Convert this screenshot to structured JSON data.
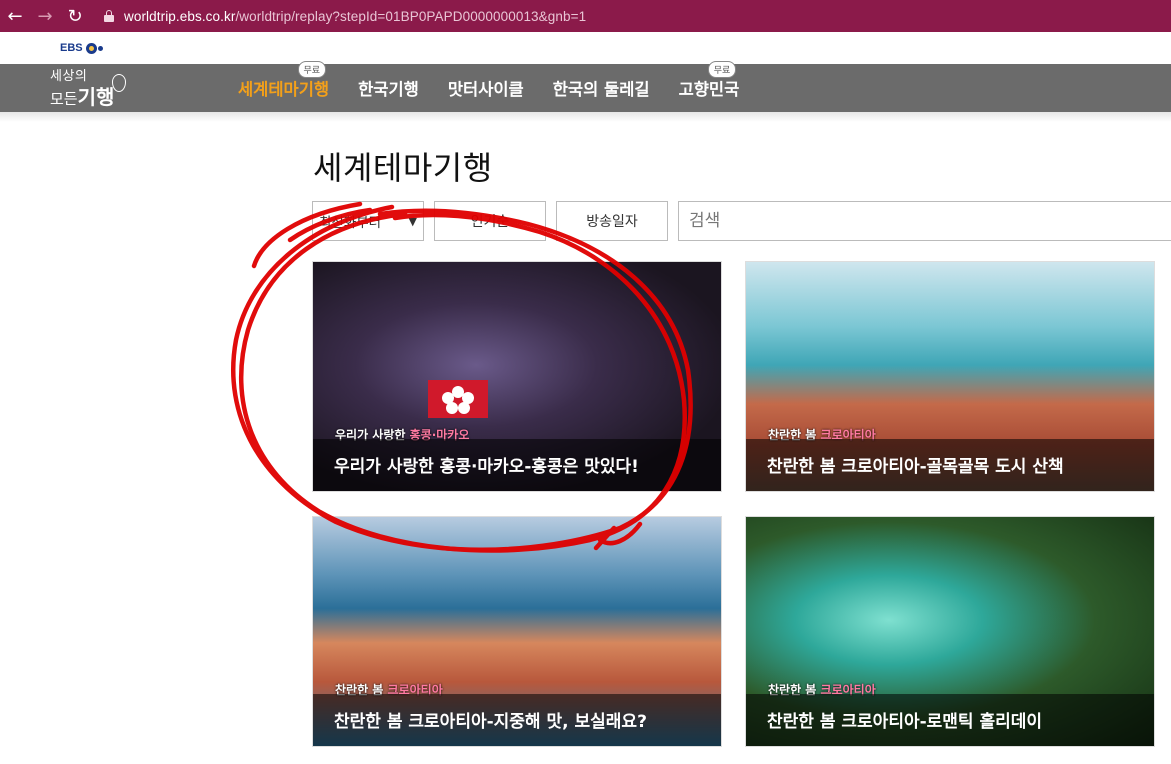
{
  "browser": {
    "url_host": "worldtrip.ebs.co.kr",
    "url_path": "/worldtrip/replay?stepId=01BP0PAPD0000000013&gnb=1",
    "back_icon": "arrow-left-icon",
    "forward_icon": "arrow-right-icon",
    "reload_icon": "reload-icon"
  },
  "ebs": {
    "label": "EBS"
  },
  "site": {
    "logo_line1": "세상의",
    "logo_line2a": "모든",
    "logo_line2b": "기행",
    "menu": [
      {
        "label": "세계테마기행",
        "badge": "무료",
        "active": true
      },
      {
        "label": "한국기행"
      },
      {
        "label": "맛터사이클"
      },
      {
        "label": "한국의 둘레길"
      },
      {
        "label": "고향민국",
        "badge": "무료"
      }
    ]
  },
  "page": {
    "title": "세계테마기행",
    "sort_select": "최신화부터",
    "popular_button": "인기순",
    "date_button": "방송일자",
    "search_placeholder": "검색"
  },
  "cards": [
    {
      "caption": "우리가 사랑한 홍콩·마카오-홍콩은 맛있다!",
      "stamp_a": "우리가 사랑한 ",
      "stamp_b": "홍콩·마카오"
    },
    {
      "caption": "찬란한 봄 크로아티아-골목골목 도시 산책",
      "stamp_a": "찬란한 봄 ",
      "stamp_b": "크로아티아"
    },
    {
      "caption": "찬란한 봄 크로아티아-지중해 맛, 보실래요?",
      "stamp_a": "찬란한 봄 ",
      "stamp_b": "크로아티아"
    },
    {
      "caption": "찬란한 봄 크로아티아-로맨틱 홀리데이",
      "stamp_a": "찬란한 봄 ",
      "stamp_b": "크로아티아"
    }
  ],
  "colors": {
    "browser_bar": "#8b1a4a",
    "nav": "#6b6b6b",
    "active_menu": "#f3a01a",
    "annotation": "#e00000"
  }
}
